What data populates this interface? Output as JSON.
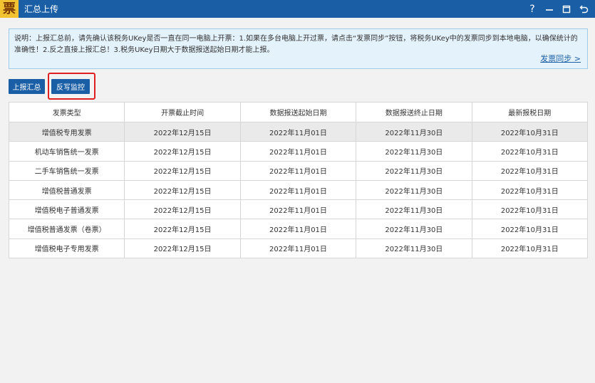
{
  "window": {
    "logo_glyph": "票",
    "title": "汇总上传",
    "help": "?",
    "minimize": "—"
  },
  "notice": {
    "text": "说明：上报汇总前，请先确认该税务UKey是否一直在同一电脑上开票：1.如果在多台电脑上开过票，请点击“发票同步”按钮，将税务UKey中的发票同步到本地电脑，以确保统计的准确性！2.反之直接上报汇总！3.税务UKey日期大于数据报送起始日期才能上报。",
    "sync_link": "发票同步 >"
  },
  "toolbar": {
    "report_label": "上报汇总",
    "monitor_label": "反写监控"
  },
  "table": {
    "headers": [
      "发票类型",
      "开票截止时间",
      "数据报送起始日期",
      "数据报送终止日期",
      "最新报税日期"
    ],
    "rows": [
      [
        "增值税专用发票",
        "2022年12月15日",
        "2022年11月01日",
        "2022年11月30日",
        "2022年10月31日"
      ],
      [
        "机动车销售统一发票",
        "2022年12月15日",
        "2022年11月01日",
        "2022年11月30日",
        "2022年10月31日"
      ],
      [
        "二手车销售统一发票",
        "2022年12月15日",
        "2022年11月01日",
        "2022年11月30日",
        "2022年10月31日"
      ],
      [
        "增值税普通发票",
        "2022年12月15日",
        "2022年11月01日",
        "2022年11月30日",
        "2022年10月31日"
      ],
      [
        "增值税电子普通发票",
        "2022年12月15日",
        "2022年11月01日",
        "2022年11月30日",
        "2022年10月31日"
      ],
      [
        "增值税普通发票（卷票）",
        "2022年12月15日",
        "2022年11月01日",
        "2022年11月30日",
        "2022年10月31日"
      ],
      [
        "增值税电子专用发票",
        "2022年12月15日",
        "2022年11月01日",
        "2022年11月30日",
        "2022年10月31日"
      ]
    ]
  },
  "colors": {
    "titlebar": "#1a5fa6",
    "highlight": "#e02020",
    "notice_bg": "#e4f2fb"
  }
}
